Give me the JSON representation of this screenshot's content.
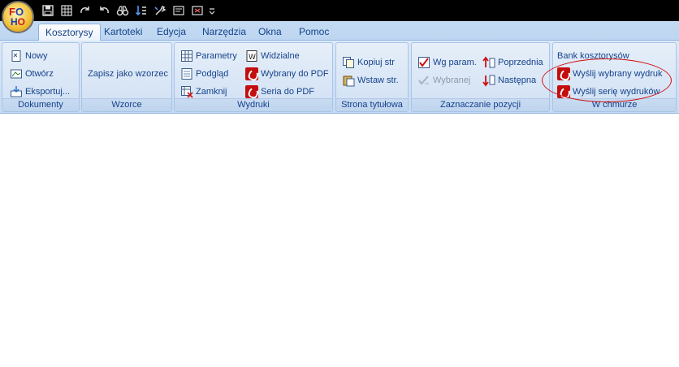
{
  "app": {
    "logo_top_f": "F",
    "logo_top_o": "O",
    "logo_bottom_h": "H",
    "logo_bottom_o": "O"
  },
  "quick_access": [
    {
      "icon": "save-icon"
    },
    {
      "icon": "grid-icon"
    },
    {
      "icon": "redo-icon"
    },
    {
      "icon": "undo-icon"
    },
    {
      "icon": "binoculars-icon"
    },
    {
      "icon": "sort-icon"
    },
    {
      "icon": "tools-icon"
    },
    {
      "icon": "dialog-icon"
    },
    {
      "icon": "fullscreen-icon"
    },
    {
      "icon": "customize-dropdown-icon"
    }
  ],
  "tabs": [
    {
      "label": "Kosztorysy",
      "active": true
    },
    {
      "label": "Kartoteki"
    },
    {
      "label": "Edycja"
    },
    {
      "label": "Narzędzia"
    },
    {
      "label": "Okna"
    },
    {
      "label": "Pomoc"
    }
  ],
  "groups": {
    "dokumenty": {
      "label": "Dokumenty",
      "items": [
        "Nowy",
        "Otwórz",
        "Eksportuj..."
      ]
    },
    "wzorce": {
      "label": "Wzorce",
      "items": [
        "Zapisz jako wzorzec"
      ]
    },
    "wydruki": {
      "label": "Wydruki",
      "col1": [
        "Parametry",
        "Podgląd",
        "Zamknij"
      ],
      "col2": [
        "Widzialne",
        "Wybrany do PDF",
        "Seria do PDF"
      ]
    },
    "strona_tytulowa": {
      "label": "Strona tytułowa",
      "items": [
        "Kopiuj str",
        "Wstaw str."
      ]
    },
    "zaznaczanie": {
      "label": "Zaznaczanie pozycji",
      "col1": [
        "Wg param.",
        "Wybranej"
      ],
      "col2": [
        "Poprzednia",
        "Następna"
      ]
    },
    "chmura": {
      "label": "W chmurze",
      "items": [
        "Bank kosztorysów",
        "Wyślij wybrany wydruk",
        "Wyślij serię wydruków"
      ]
    }
  },
  "colors": {
    "text": "#15428b",
    "pdf_red": "#c40d0d",
    "highlight": "#d01010"
  }
}
